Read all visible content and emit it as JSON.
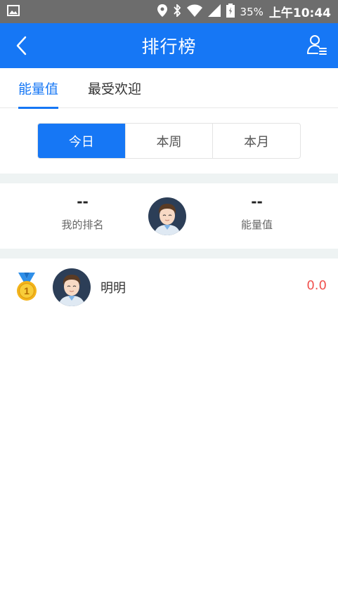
{
  "status_bar": {
    "battery": "35%",
    "time": "上午10:44"
  },
  "header": {
    "title": "排行榜"
  },
  "tabs": [
    {
      "label": "能量值",
      "active": true
    },
    {
      "label": "最受欢迎",
      "active": false
    }
  ],
  "period_segments": [
    {
      "label": "今日",
      "active": true
    },
    {
      "label": "本周",
      "active": false
    },
    {
      "label": "本月",
      "active": false
    }
  ],
  "my_summary": {
    "rank_value": "--",
    "rank_label": "我的排名",
    "energy_value": "--",
    "energy_label": "能量值"
  },
  "leaderboard": [
    {
      "rank": "1",
      "name": "明明",
      "score": "0.0"
    }
  ],
  "colors": {
    "primary": "#1677f5",
    "score": "#f0524f",
    "status_bar": "#6d6d6d"
  }
}
